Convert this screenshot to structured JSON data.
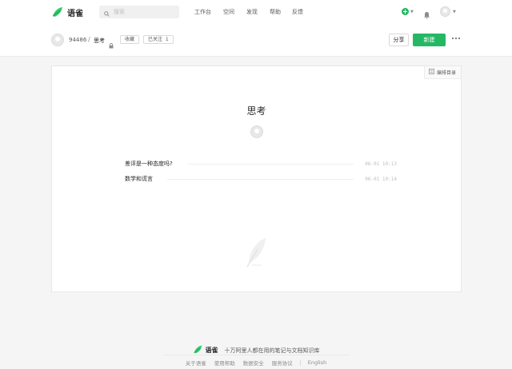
{
  "brand": {
    "name": "语雀"
  },
  "search": {
    "placeholder": "搜索"
  },
  "nav": {
    "items": [
      "工作台",
      "空间",
      "发现",
      "帮助",
      "反馈"
    ]
  },
  "icons": {
    "logo": "yuque-bird-logo",
    "search": "search-icon",
    "add": "plus-circle-icon",
    "notify": "bell-icon",
    "more": "more-horizontal-icon",
    "toc": "list-icon",
    "lock": "lock-icon",
    "empty": "feather-icon"
  },
  "colors": {
    "accent": "#25b864",
    "page_bg": "#f5f5f5"
  },
  "breadcrumb": {
    "user": "94486",
    "separator": "/",
    "book": "思考",
    "collect_label": "收藏",
    "follow_label": "已关注",
    "follow_count": "1"
  },
  "actions": {
    "share_label": "分享",
    "new_label": "新建"
  },
  "book": {
    "toc_label": "编排目录",
    "title": "思考",
    "docs": [
      {
        "title": "差评是一种态度吗?",
        "date": "06-01 10:13"
      },
      {
        "title": "数学和谎言",
        "date": "06-01 10:14"
      }
    ]
  },
  "footer": {
    "brand": "语雀",
    "slogan": "十万阿里人都在用的笔记与文档知识库",
    "links": [
      "关于语雀",
      "使用帮助",
      "数据安全",
      "服务协议",
      "English"
    ]
  }
}
